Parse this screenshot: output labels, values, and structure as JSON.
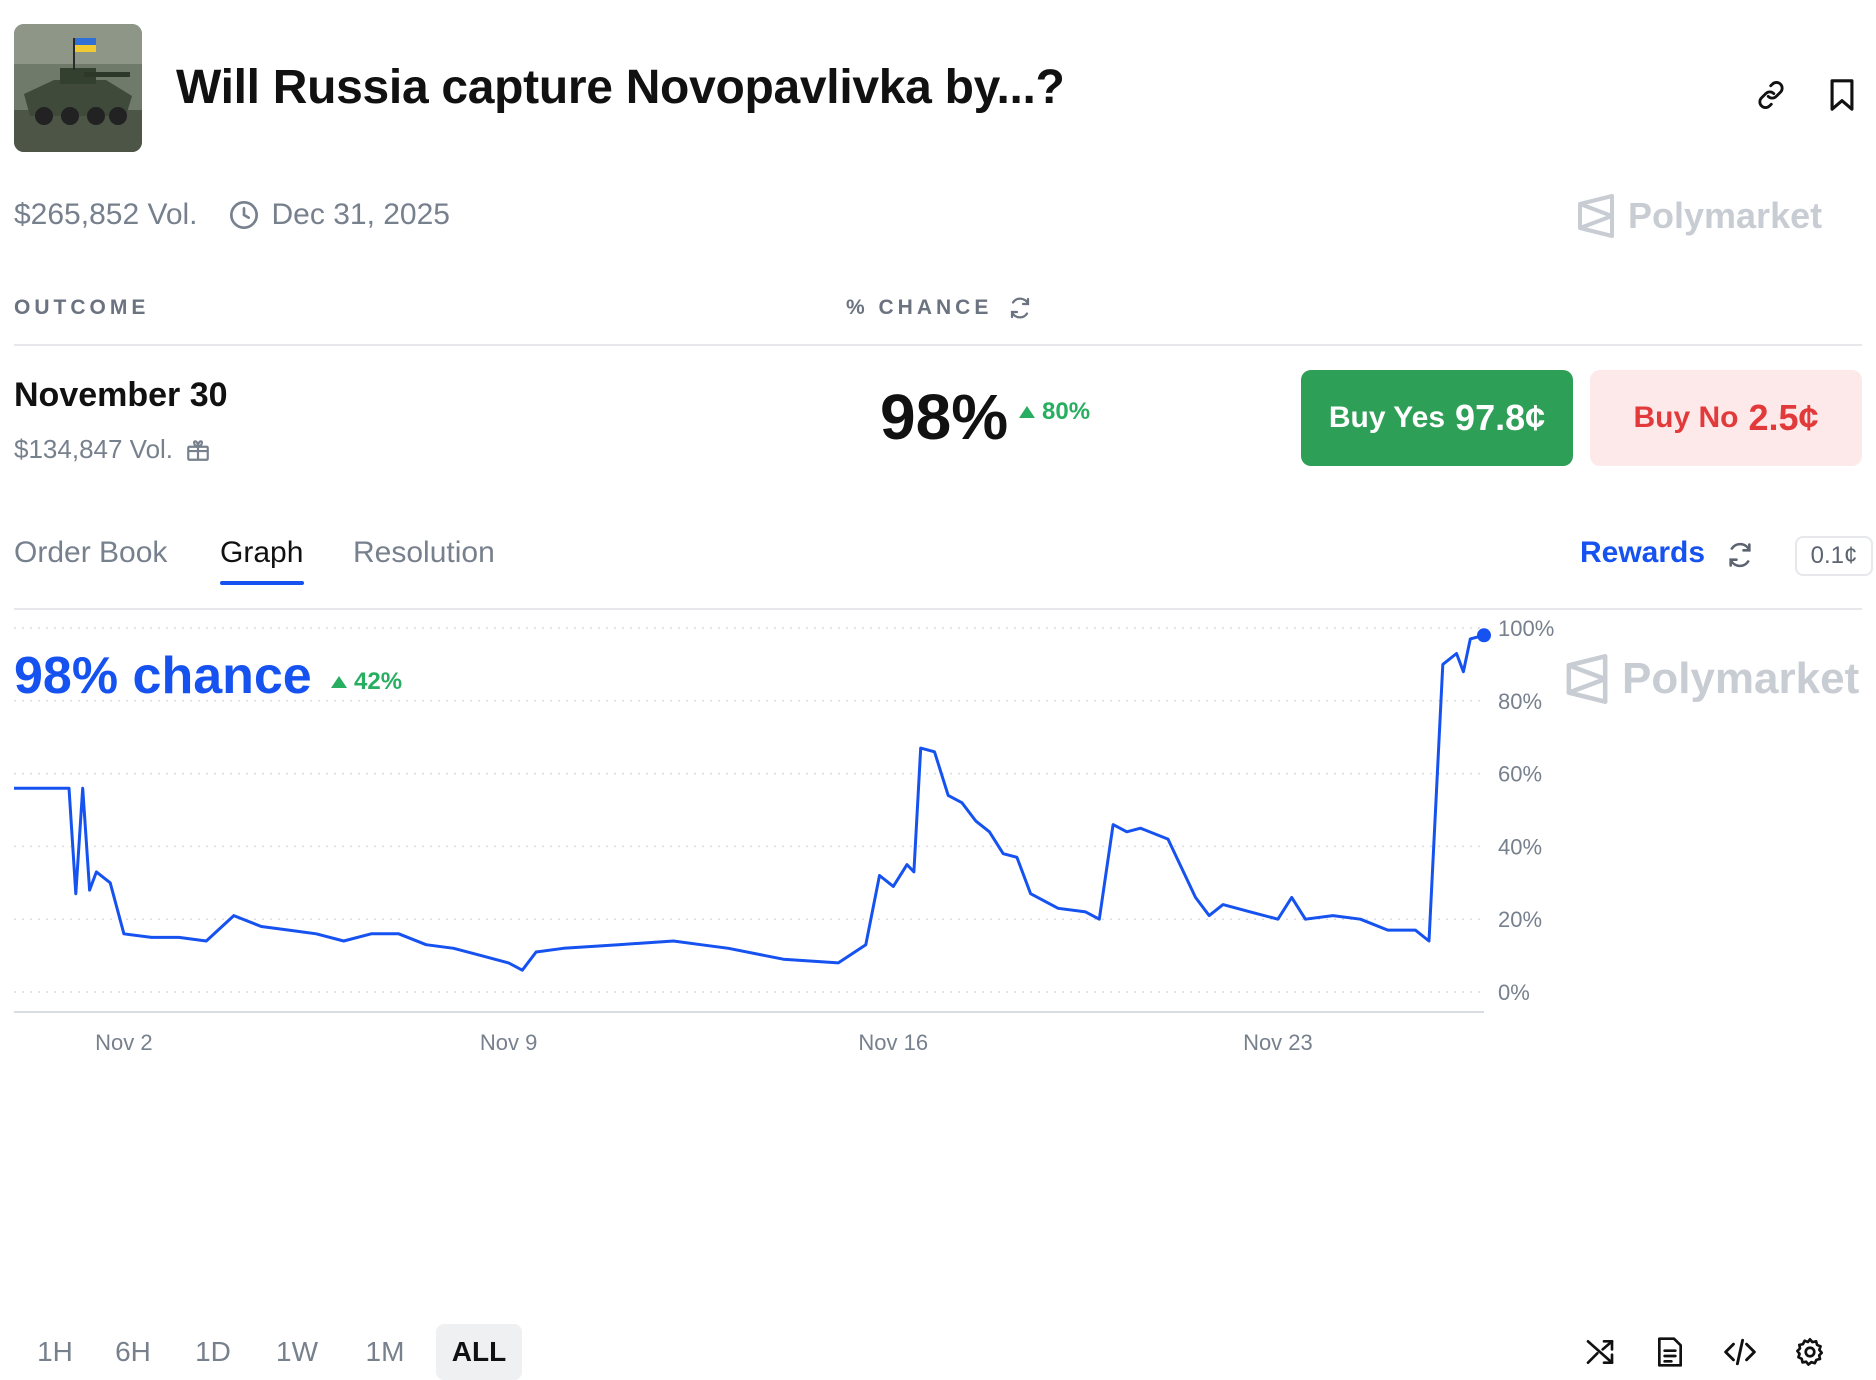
{
  "market": {
    "title": "Will Russia capture Novopavlivka by...?",
    "volume": "$265,852 Vol.",
    "end_date": "Dec 31, 2025",
    "brand": "Polymarket"
  },
  "table": {
    "outcome_header": "OUTCOME",
    "chance_header": "% CHANCE"
  },
  "outcome": {
    "name": "November 30",
    "volume": "$134,847 Vol.",
    "chance": "98%",
    "change": "80%",
    "buy_yes_label": "Buy Yes",
    "buy_yes_price": "97.8¢",
    "buy_no_label": "Buy No",
    "buy_no_price": "2.5¢"
  },
  "tabs": [
    {
      "label": "Order Book"
    },
    {
      "label": "Graph"
    },
    {
      "label": "Resolution"
    }
  ],
  "active_tab": "Graph",
  "rewards_label": "Rewards",
  "tick_size": "0.1¢",
  "graph": {
    "chance_label": "98% chance",
    "change": "42%"
  },
  "ranges": [
    {
      "label": "1H"
    },
    {
      "label": "6H"
    },
    {
      "label": "1D"
    },
    {
      "label": "1W"
    },
    {
      "label": "1M"
    },
    {
      "label": "ALL"
    }
  ],
  "active_range": "ALL",
  "colors": {
    "accent": "#1652f0",
    "up": "#27ae60",
    "buy_yes_bg": "#2e9f57",
    "buy_no_bg": "#fde9e9",
    "buy_no_text": "#e23a3a"
  },
  "chart_data": {
    "type": "line",
    "series": [
      {
        "points": [
          [
            "Oct 31",
            56
          ],
          [
            "Nov 1 00:00",
            56
          ],
          [
            "Nov 1 03:00",
            27
          ],
          [
            "Nov 1 06:00",
            56
          ],
          [
            "Nov 1 09:00",
            28
          ],
          [
            "Nov 1 12:00",
            33
          ],
          [
            "Nov 1 18:00",
            30
          ],
          [
            "Nov 2",
            16
          ],
          [
            "Nov 2 12:00",
            15
          ],
          [
            "Nov 3",
            15
          ],
          [
            "Nov 3 12:00",
            14
          ],
          [
            "Nov 4",
            21
          ],
          [
            "Nov 4 12:00",
            18
          ],
          [
            "Nov 5",
            17
          ],
          [
            "Nov 5 12:00",
            16
          ],
          [
            "Nov 6",
            14
          ],
          [
            "Nov 6 12:00",
            16
          ],
          [
            "Nov 7",
            16
          ],
          [
            "Nov 7 12:00",
            13
          ],
          [
            "Nov 8",
            12
          ],
          [
            "Nov 8 12:00",
            10
          ],
          [
            "Nov 9",
            8
          ],
          [
            "Nov 9 06:00",
            6
          ],
          [
            "Nov 9 12:00",
            11
          ],
          [
            "Nov 10",
            12
          ],
          [
            "Nov 11",
            13
          ],
          [
            "Nov 12",
            14
          ],
          [
            "Nov 12 12:00",
            13
          ],
          [
            "Nov 13",
            12
          ],
          [
            "Nov 14",
            9
          ],
          [
            "Nov 15",
            8
          ],
          [
            "Nov 15 12:00",
            13
          ],
          [
            "Nov 15 18:00",
            32
          ],
          [
            "Nov 16",
            29
          ],
          [
            "Nov 16 06:00",
            35
          ],
          [
            "Nov 16 09:00",
            33
          ],
          [
            "Nov 16 12:00",
            67
          ],
          [
            "Nov 16 18:00",
            66
          ],
          [
            "Nov 17",
            54
          ],
          [
            "Nov 17 06:00",
            52
          ],
          [
            "Nov 17 12:00",
            47
          ],
          [
            "Nov 17 18:00",
            44
          ],
          [
            "Nov 18",
            38
          ],
          [
            "Nov 18 06:00",
            37
          ],
          [
            "Nov 18 12:00",
            27
          ],
          [
            "Nov 19",
            23
          ],
          [
            "Nov 19 12:00",
            22
          ],
          [
            "Nov 19 18:00",
            20
          ],
          [
            "Nov 20",
            46
          ],
          [
            "Nov 20 06:00",
            44
          ],
          [
            "Nov 20 12:00",
            45
          ],
          [
            "Nov 21",
            42
          ],
          [
            "Nov 21 12:00",
            26
          ],
          [
            "Nov 21 18:00",
            21
          ],
          [
            "Nov 22",
            24
          ],
          [
            "Nov 22 12:00",
            22
          ],
          [
            "Nov 23",
            20
          ],
          [
            "Nov 23 06:00",
            26
          ],
          [
            "Nov 23 12:00",
            20
          ],
          [
            "Nov 24",
            21
          ],
          [
            "Nov 24 12:00",
            20
          ],
          [
            "Nov 25",
            17
          ],
          [
            "Nov 25 12:00",
            17
          ],
          [
            "Nov 25 18:00",
            14
          ],
          [
            "Nov 26",
            90
          ],
          [
            "Nov 26 06:00",
            93
          ],
          [
            "Nov 26 09:00",
            88
          ],
          [
            "Nov 26 12:00",
            97
          ],
          [
            "Nov 26 18:00",
            98
          ]
        ]
      }
    ],
    "x_ticks": [
      "Nov 2",
      "Nov 9",
      "Nov 16",
      "Nov 23"
    ],
    "y_ticks": [
      "0%",
      "20%",
      "40%",
      "60%",
      "80%",
      "100%"
    ],
    "ylim": [
      0,
      100
    ],
    "grid": true,
    "y_axis_side": "right"
  }
}
